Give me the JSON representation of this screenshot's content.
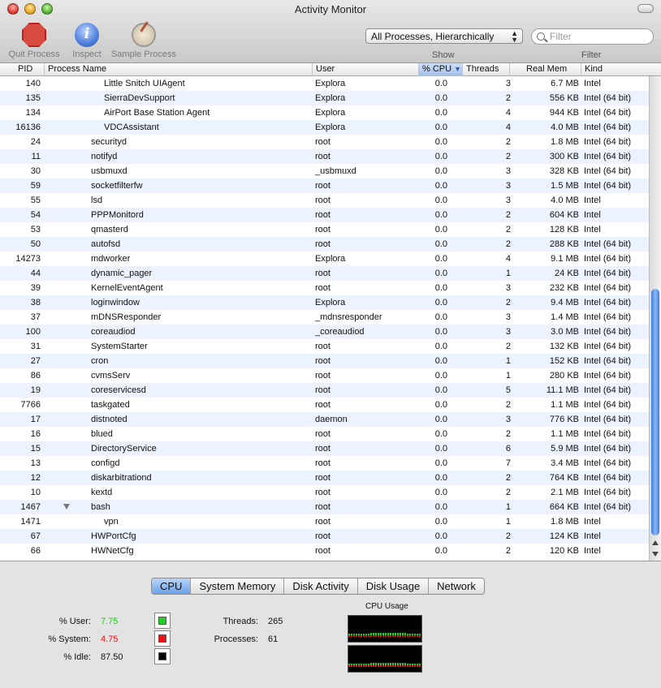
{
  "window": {
    "title": "Activity Monitor"
  },
  "toolbar": {
    "quit_label": "Quit Process",
    "inspect_label": "Inspect",
    "sample_label": "Sample Process",
    "show_value": "All Processes, Hierarchically",
    "show_label": "Show",
    "filter_placeholder": "Filter",
    "filter_label": "Filter"
  },
  "columns": {
    "pid": "PID",
    "name": "Process Name",
    "user": "User",
    "cpu": "% CPU",
    "threads": "Threads",
    "mem": "Real Mem",
    "kind": "Kind"
  },
  "rows": [
    {
      "pid": "140",
      "name": "Little Snitch UIAgent",
      "user": "Explora",
      "cpu": "0.0",
      "threads": "3",
      "mem": "6.7 MB",
      "kind": "Intel",
      "indent": 2
    },
    {
      "pid": "135",
      "name": "SierraDevSupport",
      "user": "Explora",
      "cpu": "0.0",
      "threads": "2",
      "mem": "556 KB",
      "kind": "Intel (64 bit)",
      "indent": 2
    },
    {
      "pid": "134",
      "name": "AirPort Base Station Agent",
      "user": "Explora",
      "cpu": "0.0",
      "threads": "4",
      "mem": "944 KB",
      "kind": "Intel (64 bit)",
      "indent": 2
    },
    {
      "pid": "16136",
      "name": "VDCAssistant",
      "user": "Explora",
      "cpu": "0.0",
      "threads": "4",
      "mem": "4.0 MB",
      "kind": "Intel (64 bit)",
      "indent": 2
    },
    {
      "pid": "24",
      "name": "securityd",
      "user": "root",
      "cpu": "0.0",
      "threads": "2",
      "mem": "1.8 MB",
      "kind": "Intel (64 bit)",
      "indent": 1
    },
    {
      "pid": "11",
      "name": "notifyd",
      "user": "root",
      "cpu": "0.0",
      "threads": "2",
      "mem": "300 KB",
      "kind": "Intel (64 bit)",
      "indent": 1
    },
    {
      "pid": "30",
      "name": "usbmuxd",
      "user": "_usbmuxd",
      "cpu": "0.0",
      "threads": "3",
      "mem": "328 KB",
      "kind": "Intel (64 bit)",
      "indent": 1
    },
    {
      "pid": "59",
      "name": "socketfilterfw",
      "user": "root",
      "cpu": "0.0",
      "threads": "3",
      "mem": "1.5 MB",
      "kind": "Intel (64 bit)",
      "indent": 1
    },
    {
      "pid": "55",
      "name": "lsd",
      "user": "root",
      "cpu": "0.0",
      "threads": "3",
      "mem": "4.0 MB",
      "kind": "Intel",
      "indent": 1
    },
    {
      "pid": "54",
      "name": "PPPMonitord",
      "user": "root",
      "cpu": "0.0",
      "threads": "2",
      "mem": "604 KB",
      "kind": "Intel",
      "indent": 1
    },
    {
      "pid": "53",
      "name": "qmasterd",
      "user": "root",
      "cpu": "0.0",
      "threads": "2",
      "mem": "128 KB",
      "kind": "Intel",
      "indent": 1
    },
    {
      "pid": "50",
      "name": "autofsd",
      "user": "root",
      "cpu": "0.0",
      "threads": "2",
      "mem": "288 KB",
      "kind": "Intel (64 bit)",
      "indent": 1
    },
    {
      "pid": "14273",
      "name": "mdworker",
      "user": "Explora",
      "cpu": "0.0",
      "threads": "4",
      "mem": "9.1 MB",
      "kind": "Intel (64 bit)",
      "indent": 1
    },
    {
      "pid": "44",
      "name": "dynamic_pager",
      "user": "root",
      "cpu": "0.0",
      "threads": "1",
      "mem": "24 KB",
      "kind": "Intel (64 bit)",
      "indent": 1
    },
    {
      "pid": "39",
      "name": "KernelEventAgent",
      "user": "root",
      "cpu": "0.0",
      "threads": "3",
      "mem": "232 KB",
      "kind": "Intel (64 bit)",
      "indent": 1
    },
    {
      "pid": "38",
      "name": "loginwindow",
      "user": "Explora",
      "cpu": "0.0",
      "threads": "2",
      "mem": "9.4 MB",
      "kind": "Intel (64 bit)",
      "indent": 1
    },
    {
      "pid": "37",
      "name": "mDNSResponder",
      "user": "_mdnsresponder",
      "cpu": "0.0",
      "threads": "3",
      "mem": "1.4 MB",
      "kind": "Intel (64 bit)",
      "indent": 1
    },
    {
      "pid": "100",
      "name": "coreaudiod",
      "user": "_coreaudiod",
      "cpu": "0.0",
      "threads": "3",
      "mem": "3.0 MB",
      "kind": "Intel (64 bit)",
      "indent": 1
    },
    {
      "pid": "31",
      "name": "SystemStarter",
      "user": "root",
      "cpu": "0.0",
      "threads": "2",
      "mem": "132 KB",
      "kind": "Intel (64 bit)",
      "indent": 1
    },
    {
      "pid": "27",
      "name": "cron",
      "user": "root",
      "cpu": "0.0",
      "threads": "1",
      "mem": "152 KB",
      "kind": "Intel (64 bit)",
      "indent": 1
    },
    {
      "pid": "86",
      "name": "cvmsServ",
      "user": "root",
      "cpu": "0.0",
      "threads": "1",
      "mem": "280 KB",
      "kind": "Intel (64 bit)",
      "indent": 1
    },
    {
      "pid": "19",
      "name": "coreservicesd",
      "user": "root",
      "cpu": "0.0",
      "threads": "5",
      "mem": "11.1 MB",
      "kind": "Intel (64 bit)",
      "indent": 1
    },
    {
      "pid": "7766",
      "name": "taskgated",
      "user": "root",
      "cpu": "0.0",
      "threads": "2",
      "mem": "1.1 MB",
      "kind": "Intel (64 bit)",
      "indent": 1
    },
    {
      "pid": "17",
      "name": "distnoted",
      "user": "daemon",
      "cpu": "0.0",
      "threads": "3",
      "mem": "776 KB",
      "kind": "Intel (64 bit)",
      "indent": 1
    },
    {
      "pid": "16",
      "name": "blued",
      "user": "root",
      "cpu": "0.0",
      "threads": "2",
      "mem": "1.1 MB",
      "kind": "Intel (64 bit)",
      "indent": 1
    },
    {
      "pid": "15",
      "name": "DirectoryService",
      "user": "root",
      "cpu": "0.0",
      "threads": "6",
      "mem": "5.9 MB",
      "kind": "Intel (64 bit)",
      "indent": 1
    },
    {
      "pid": "13",
      "name": "configd",
      "user": "root",
      "cpu": "0.0",
      "threads": "7",
      "mem": "3.4 MB",
      "kind": "Intel (64 bit)",
      "indent": 1
    },
    {
      "pid": "12",
      "name": "diskarbitrationd",
      "user": "root",
      "cpu": "0.0",
      "threads": "2",
      "mem": "764 KB",
      "kind": "Intel (64 bit)",
      "indent": 1
    },
    {
      "pid": "10",
      "name": "kextd",
      "user": "root",
      "cpu": "0.0",
      "threads": "2",
      "mem": "2.1 MB",
      "kind": "Intel (64 bit)",
      "indent": 1
    },
    {
      "pid": "1467",
      "name": "bash",
      "user": "root",
      "cpu": "0.0",
      "threads": "1",
      "mem": "664 KB",
      "kind": "Intel (64 bit)",
      "indent": 1,
      "expanded": true
    },
    {
      "pid": "1471",
      "name": "vpn",
      "user": "root",
      "cpu": "0.0",
      "threads": "1",
      "mem": "1.8 MB",
      "kind": "Intel",
      "indent": 2
    },
    {
      "pid": "67",
      "name": "HWPortCfg",
      "user": "root",
      "cpu": "0.0",
      "threads": "2",
      "mem": "124 KB",
      "kind": "Intel",
      "indent": 1
    },
    {
      "pid": "66",
      "name": "HWNetCfg",
      "user": "root",
      "cpu": "0.0",
      "threads": "2",
      "mem": "120 KB",
      "kind": "Intel",
      "indent": 1
    }
  ],
  "tabs": [
    "CPU",
    "System Memory",
    "Disk Activity",
    "Disk Usage",
    "Network"
  ],
  "active_tab": "CPU",
  "cpu_stats": {
    "user_label": "% User:",
    "user_value": "7.75",
    "user_color": "#22cc22",
    "system_label": "% System:",
    "system_value": "4.75",
    "system_color": "#ee1111",
    "idle_label": "% Idle:",
    "idle_value": "87.50",
    "idle_color": "#000000",
    "threads_label": "Threads:",
    "threads_value": "265",
    "processes_label": "Processes:",
    "processes_value": "61",
    "usage_title": "CPU Usage"
  }
}
